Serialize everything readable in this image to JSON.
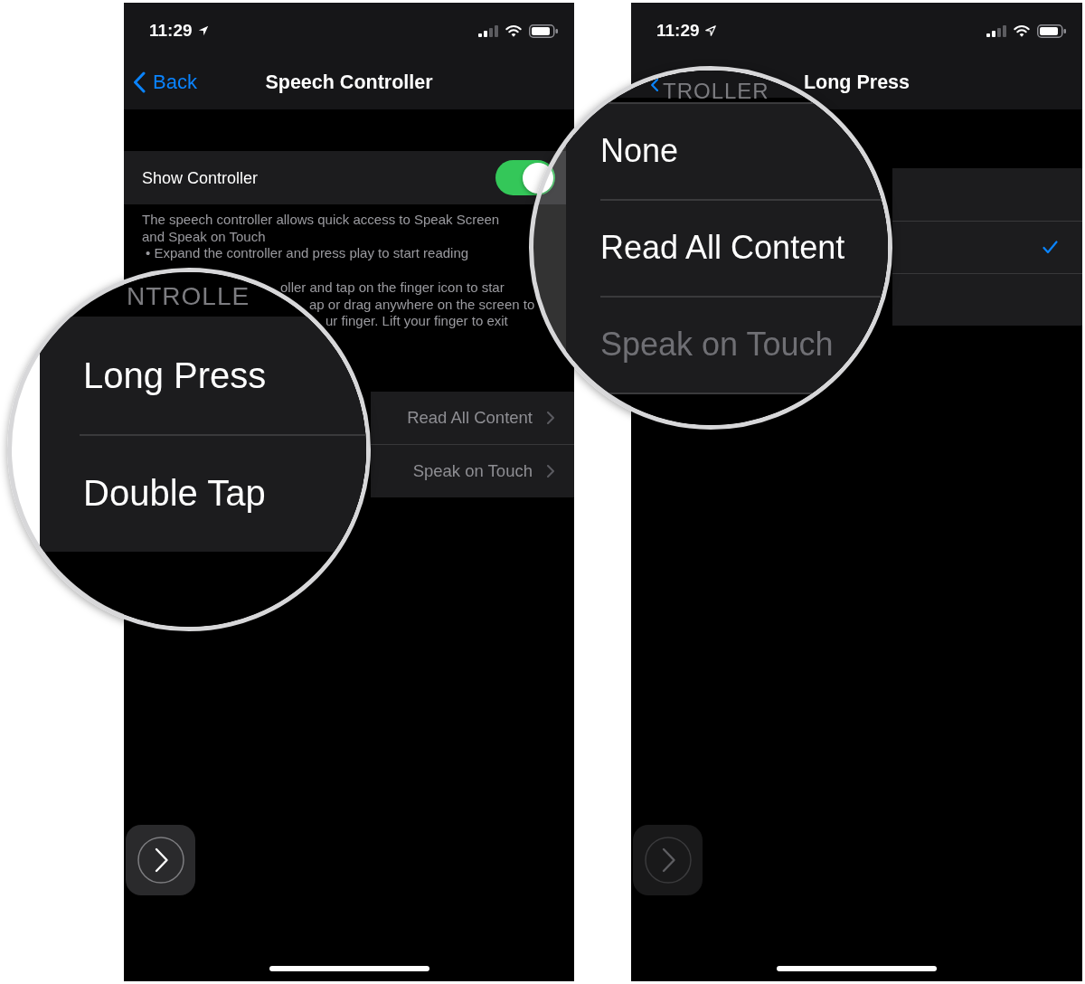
{
  "left_screen": {
    "status_bar": {
      "time": "11:29",
      "location_arrow": {
        "kind": "filled"
      }
    },
    "nav_bar": {
      "back": "Back",
      "title": "Speech Controller"
    },
    "show_controller": {
      "label": "Show Controller",
      "on": true
    },
    "footer_lines": [
      "The speech controller allows quick access to Speak Screen",
      "and Speak on Touch",
      "• Expand the controller and press play to start reading",
      "oller and tap on the finger icon to star",
      "ap or drag anywhere on the screen to",
      "ur finger. Lift your finger to exit"
    ],
    "rows": [
      {
        "value": "Read All Content"
      },
      {
        "value": "Speak on Touch"
      }
    ],
    "controller_button": {
      "dimmed": false
    }
  },
  "left_magnifier": {
    "header": "NTROLLE",
    "items": [
      {
        "label": "Long Press"
      },
      {
        "label": "Double Tap"
      }
    ]
  },
  "right_screen": {
    "status_bar": {
      "time": "11:29",
      "location_arrow": {
        "kind": "outline"
      }
    },
    "nav_bar": {
      "title": "Long Press"
    },
    "options": [
      {
        "selected": false
      },
      {
        "selected": true
      },
      {
        "selected": false
      }
    ],
    "controller_button": {
      "dimmed": true
    }
  },
  "right_magnifier": {
    "header": "TROLLER",
    "items": [
      {
        "label": "None",
        "disabled": false
      },
      {
        "label": "Read All Content",
        "disabled": false
      },
      {
        "label": "Speak on Touch",
        "disabled": true
      }
    ]
  }
}
